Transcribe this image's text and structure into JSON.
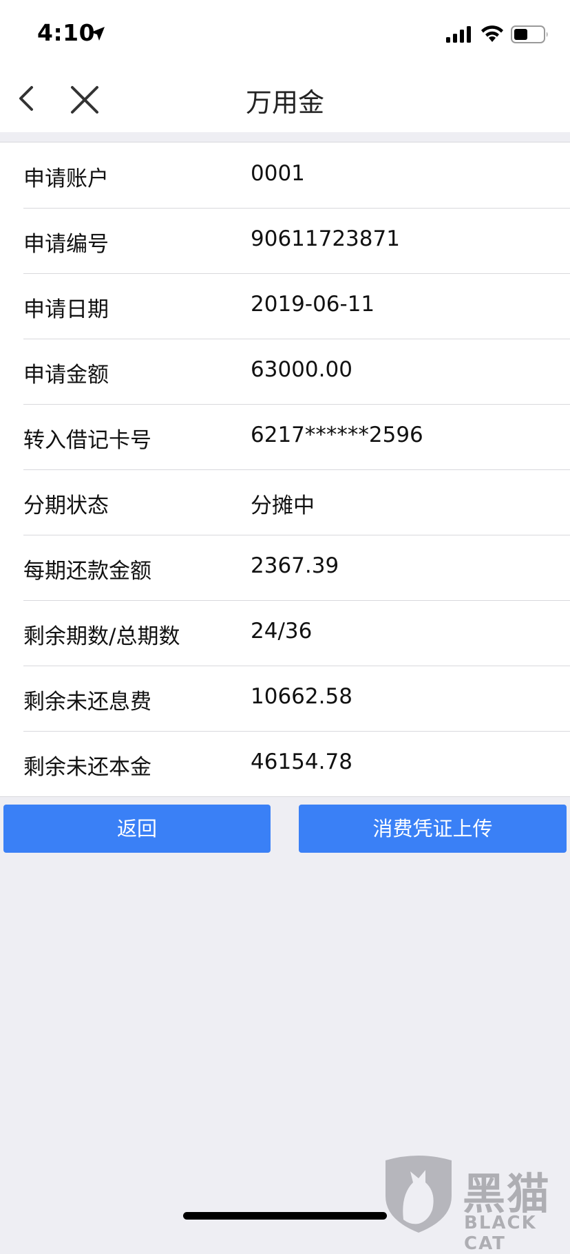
{
  "status_bar": {
    "time": "4:10",
    "icons": [
      "location-arrow-icon",
      "signal-icon",
      "wifi-icon",
      "battery-icon"
    ]
  },
  "nav": {
    "title": "万用金",
    "back_icon": "chevron-left-icon",
    "close_icon": "close-icon"
  },
  "details": [
    {
      "label": "申请账户",
      "value": "0001"
    },
    {
      "label": "申请编号",
      "value": "90611723871"
    },
    {
      "label": "申请日期",
      "value": "2019-06-11"
    },
    {
      "label": "申请金额",
      "value": "63000.00"
    },
    {
      "label": "转入借记卡号",
      "value": "6217******2596"
    },
    {
      "label": "分期状态",
      "value": "分摊中"
    },
    {
      "label": "每期还款金额",
      "value": "2367.39"
    },
    {
      "label": "剩余期数/总期数",
      "value": "24/36"
    },
    {
      "label": "剩余未还息费",
      "value": "10662.58"
    },
    {
      "label": "剩余未还本金",
      "value": "46154.78"
    }
  ],
  "buttons": {
    "back_label": "返回",
    "upload_label": "消费凭证上传"
  },
  "watermark": {
    "text": "黑猫",
    "subtext": "BLACK CAT"
  },
  "colors": {
    "accent": "#3a80f6",
    "background": "#eeeef3",
    "card": "#ffffff",
    "divider": "#d8d8dc"
  }
}
